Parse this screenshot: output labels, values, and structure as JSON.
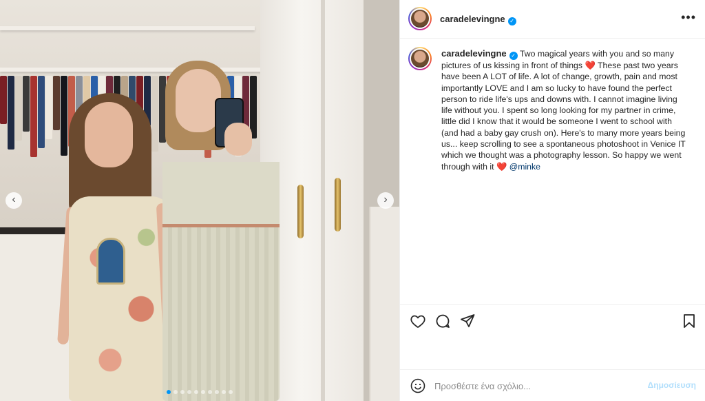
{
  "post": {
    "username": "caradelevingne",
    "verified_mark": "✓",
    "more_icon": "more-horizontal-icon",
    "caption": {
      "username": "caradelevingne",
      "text_1": "Two magical years with you and so many pictures of us kissing in front of things",
      "heart_1": "❤️",
      "text_2": "These past two years have been A LOT of life. A lot of change, growth, pain and most importantly LOVE and I am so lucky to have found the perfect person to ride life's ups and downs with. I cannot imagine living life without you. I spent so long looking for my partner in crime, little did I know that it would be someone I went to school with (and had a baby gay crush on). Here's to many more years being us... keep scrolling to see a spontaneous photoshoot in Venice",
      "venice_glyph": "ΙΤ",
      "text_3": "which we thought was a photography lesson. So happy we went through with it",
      "heart_2": "❤️",
      "mention": "@minke"
    }
  },
  "carousel": {
    "prev_glyph": "‹",
    "next_glyph": "›",
    "dot_count": 10,
    "active_index": 0
  },
  "actions": {
    "like_icon": "heart-icon",
    "comment_icon": "comment-icon",
    "share_icon": "send-icon",
    "save_icon": "bookmark-icon"
  },
  "comment_box": {
    "emoji_icon": "smiley-icon",
    "placeholder": "Προσθέστε ένα σχόλιο...",
    "post_label": "Δημοσίευση"
  },
  "colors": {
    "verified_blue": "#0095f6",
    "heart_red": "#ed1c2a",
    "mention_blue": "#00376b",
    "post_button_disabled": "#b2dffc"
  }
}
